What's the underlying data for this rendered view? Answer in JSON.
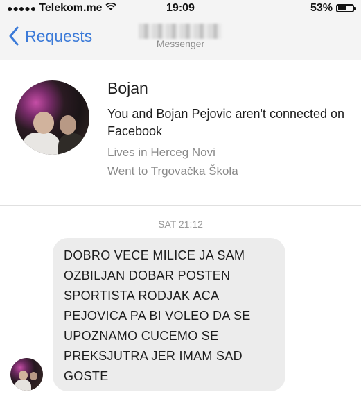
{
  "status_bar": {
    "signal_dots": "●●●●●",
    "carrier": "Telekom.me",
    "wifi_icon": "wifi-icon",
    "time": "19:09",
    "battery_percent": "53%",
    "battery_level": 0.53
  },
  "nav": {
    "back_label": "Requests",
    "subtitle": "Messenger"
  },
  "profile": {
    "name": "Bojan",
    "connection": "You and Bojan Pejovic aren't connected on Facebook",
    "lives": "Lives in Herceg Novi",
    "went": "Went to Trgovačka Škola"
  },
  "chat": {
    "timestamp": "SAT 21:12",
    "message_lines": [
      "DOBRO VECE MILICE JA SAM",
      "OZBILJAN DOBAR POSTEN",
      "SPORTISTA RODJAK ACA",
      "PEJOVICA PA BI VOLEO DA SE",
      "UPOZNAMO CUCEMO SE",
      "PREKSJUTRA JER IMAM SAD",
      "GOSTE"
    ]
  },
  "colors": {
    "accent": "#3b7ad8",
    "bubble": "#ececec",
    "muted": "#8a8a8a"
  }
}
